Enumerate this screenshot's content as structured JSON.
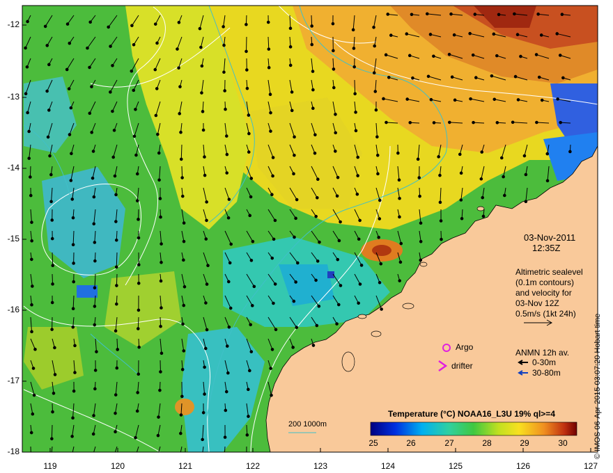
{
  "map": {
    "y_ticks": [
      "-12",
      "-13",
      "-14",
      "-15",
      "-16",
      "-17",
      "-18"
    ],
    "x_ticks": [
      "119",
      "120",
      "121",
      "122",
      "123",
      "124",
      "125",
      "126",
      "127"
    ],
    "date": "03-Nov-2011",
    "time": "12:35Z",
    "altimetry_text": [
      "Altimetric sealevel",
      "(0.1m contours)",
      "and velocity for",
      "03-Nov 12Z",
      "0.5m/s (1kt 24h)"
    ],
    "argo_label": "Argo",
    "drifter_label": "drifter",
    "anmn_title": "ANMN 12h av.",
    "anmn_shallow": "0-30m",
    "anmn_deep": "30-80m",
    "depth_contours": "200  1000m",
    "colorbar_title": "Temperature (°C) NOAA16_L3U 19% ql>=4",
    "colorbar_ticks": [
      "25",
      "26",
      "27",
      "28",
      "29",
      "30"
    ],
    "credit": "© IMOS 06-Apr-2015 03:07:20 Hobart time",
    "colors": {
      "land": "#f9c99a",
      "argo": "#e020e0",
      "contour": "#ffffff",
      "isobath": "#40c0c8"
    }
  }
}
